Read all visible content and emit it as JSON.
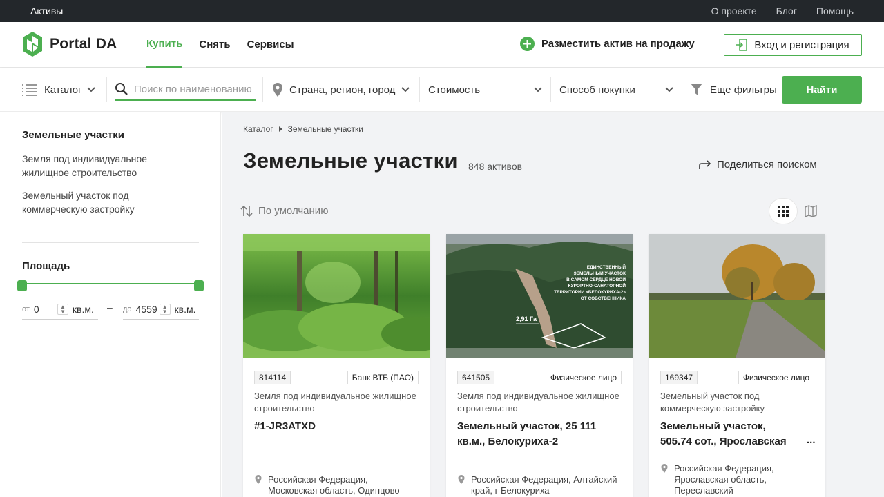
{
  "topbar": {
    "brand": "Активы",
    "links": [
      "О проекте",
      "Блог",
      "Помощь"
    ]
  },
  "header": {
    "logo_text": "Portal DA",
    "nav": [
      {
        "label": "Купить",
        "active": true
      },
      {
        "label": "Снять",
        "active": false
      },
      {
        "label": "Сервисы",
        "active": false
      }
    ],
    "post_ad_label": "Разместить актив на продажу",
    "login_label": "Вход и регистрация"
  },
  "filters": {
    "catalog_label": "Каталог",
    "search_placeholder": "Поиск по наименованию",
    "location_label": "Страна, регион, город",
    "price_label": "Стоимость",
    "purchase_label": "Способ покупки",
    "more_filters_label": "Еще фильтры",
    "find_label": "Найти"
  },
  "sidebar": {
    "title": "Земельные участки",
    "links": [
      "Земля под индивидуальное жилищное строительство",
      "Земельный участок под коммерческую застройку"
    ],
    "area_title": "Площадь",
    "from_prefix": "от",
    "from_value": "0",
    "to_prefix": "до",
    "to_value": "4559",
    "unit": "кв.м.",
    "dash": "–"
  },
  "main": {
    "breadcrumb": [
      "Каталог",
      "Земельные участки"
    ],
    "title": "Земельные участки",
    "count": "848 активов",
    "share_label": "Поделиться поиском",
    "sort_label": "По умолчанию"
  },
  "cards": [
    {
      "id": "814114",
      "owner": "Банк ВТБ (ПАО)",
      "category": "Земля под индивидуальное жилищное строительство",
      "title": "#1-JR3ATXD",
      "location": "Российская Федерация, Московская область, Одинцово"
    },
    {
      "id": "641505",
      "owner": "Физическое лицо",
      "category": "Земля под индивидуальное жилищное строительство",
      "title": "Земельный участок, 25 111 кв.м., Белокуриха-2",
      "location": "Российская Федерация, Алтайский край, г Белокуриха",
      "image_text": {
        "caption": [
          "ЕДИНСТВЕННЫЙ",
          "ЗЕМЕЛЬНЫЙ УЧАСТОК",
          "В САМОМ СЕРДЦЕ НОВОЙ",
          "КУРОРТНО-САНАТОРНОЙ",
          "ТЕРРИТОРИИ «БЕЛОКУРИХА-2»",
          "ОТ СОБСТВЕННИКА"
        ],
        "area": "2,91 Га"
      }
    },
    {
      "id": "169347",
      "owner": "Физическое лицо",
      "category": "Земельный участок под коммерческую застройку",
      "title": "Земельный участок, 505.74 сот., Ярославская",
      "ellipsis": "...",
      "location": "Российская Федерация, Ярославская область, Переславский"
    }
  ],
  "colors": {
    "accent": "#4caf50",
    "topbar_bg": "#23272b",
    "main_bg": "#f2f3f5"
  }
}
